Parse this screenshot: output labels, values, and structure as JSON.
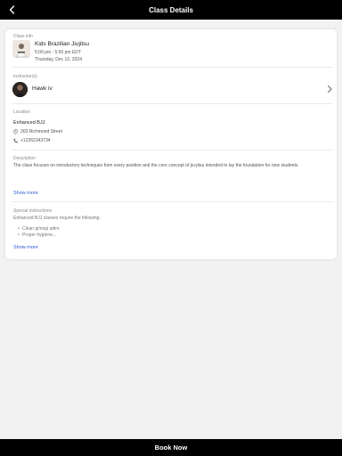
{
  "header": {
    "title": "Class Details",
    "back_icon": "chevron-left-icon"
  },
  "class_info": {
    "label": "Class info",
    "name": "Kids Brazilian Jiujitsu",
    "time": "5:00 pm - 5:50 pm EDT",
    "date": "Thursday, Dec 12, 2024"
  },
  "instructors": {
    "label": "Instructor(s)",
    "name": "Hawk iv",
    "chevron_icon": "chevron-right-icon"
  },
  "location": {
    "label": "Location",
    "name": "Enhanced BJJ",
    "address": "303 Richmond Street",
    "phone": "+12262343734",
    "address_icon": "map-pin-icon",
    "phone_icon": "phone-icon"
  },
  "description": {
    "label": "Description",
    "text": "The class focuses on introductory techniques from every position and the core concept of jiu-jitsu intended to lay the foundation for new students.",
    "show_more": "Show more"
  },
  "special_instructions": {
    "label": "Special instructions",
    "text": "Enhanced BJJ classes require the following:",
    "items": [
      "Clean gi/nogi attire",
      "Proper hygiene..."
    ],
    "show_more": "Show more"
  },
  "footer": {
    "book_label": "Book Now"
  },
  "colors": {
    "bar": "#000000",
    "link": "#2f5bd3",
    "background": "#f2f2f2"
  }
}
